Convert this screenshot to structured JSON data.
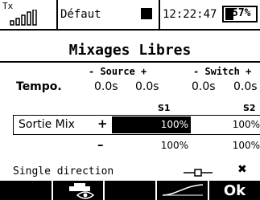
{
  "status_bar": {
    "tx_label": "Tx",
    "model_name": "Défaut",
    "time": "12:22:47",
    "battery_percent": "57%"
  },
  "screen": {
    "title": "Mixages Libres",
    "headers": {
      "source": "- Source +",
      "switch": "- Switch +"
    },
    "tempo": {
      "label": "Tempo.",
      "values": [
        "0.0s",
        "0.0s",
        "0.0s",
        "0.0s"
      ]
    },
    "columns": [
      "S1",
      "S2"
    ],
    "rows": [
      {
        "label": "Sortie Mix",
        "sign": "+",
        "s1": "100%",
        "s2": "100%"
      },
      {
        "label": "",
        "sign": "–",
        "s1": "100%",
        "s2": "100%"
      }
    ],
    "single_direction": {
      "label": "Single direction",
      "value": "✖"
    }
  },
  "softkeys": {
    "ok": "Ok"
  }
}
